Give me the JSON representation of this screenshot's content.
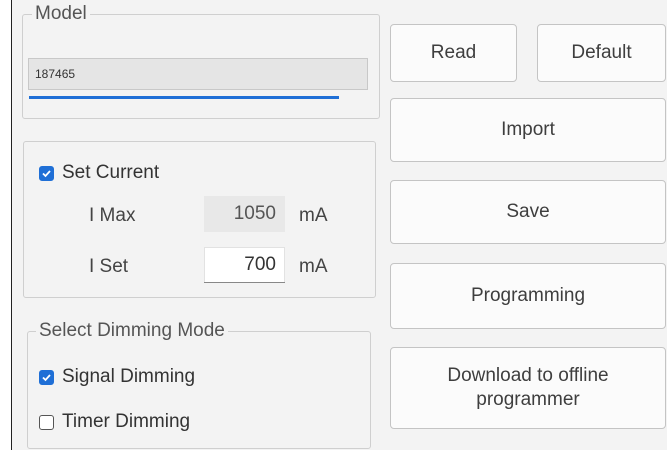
{
  "model": {
    "legend": "Model",
    "value": "187465"
  },
  "buttons": {
    "read": "Read",
    "default": "Default",
    "import": "Import",
    "save": "Save",
    "programming": "Programming",
    "download_line1": "Download to offline",
    "download_line2": "programmer"
  },
  "current": {
    "checkbox_label": "Set Current",
    "checked": true,
    "imax_label": "I Max",
    "imax_value": "1050",
    "imax_unit": "mA",
    "iset_label": "I Set",
    "iset_value": "700",
    "iset_unit": "mA"
  },
  "dimming": {
    "legend": "Select Dimming Mode",
    "signal_label": "Signal Dimming",
    "signal_checked": true,
    "timer_label": "Timer Dimming",
    "timer_checked": false
  },
  "colors": {
    "accent": "#1f6fd6",
    "panel_bg": "#f3f3f3",
    "field_readonly_bg": "#e8e8e8"
  }
}
